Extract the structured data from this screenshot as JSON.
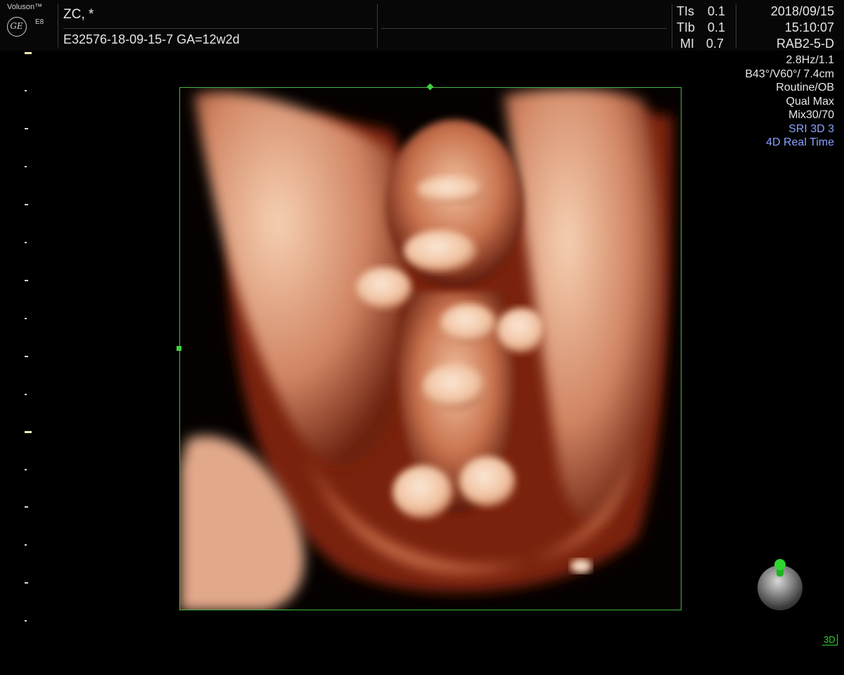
{
  "header": {
    "brand": "Voluson™",
    "logo_text": "GE",
    "model": "E8",
    "patient": "ZC,   *",
    "exam": "E32576-18-09-15-7   GA=12w2d",
    "indices": [
      {
        "label": "TIs",
        "value": "0.1"
      },
      {
        "label": "TIb",
        "value": "0.1"
      },
      {
        "label": "MI",
        "value": "0.7"
      }
    ],
    "date": "2018/09/15",
    "time": "15:10:07",
    "probe": "RAB2-5-D"
  },
  "params": {
    "frame_rate": "2.8Hz/1.1",
    "angles": "B43°/V60°/ 7.4cm",
    "preset": "Routine/OB",
    "quality": "Qual Max",
    "mix": "Mix30/70",
    "sri": "SRI 3D 3",
    "mode": "4D Real Time"
  },
  "colors": {
    "roi_border": "#3fb83f",
    "accent_blue": "#8aa0ff",
    "accent_green": "#2fd62f"
  },
  "indicator": {
    "label": "3D"
  }
}
